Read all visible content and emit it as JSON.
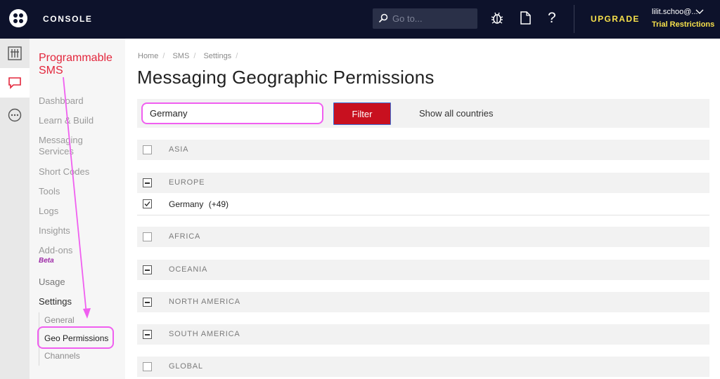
{
  "topbar": {
    "console_label": "CONSOLE",
    "search_placeholder": "Go to...",
    "upgrade_label": "UPGRADE",
    "account_name": "lilit.schoo@...",
    "trial_label": "Trial Restrictions"
  },
  "sidebar": {
    "product_title": "Programmable SMS",
    "items": [
      {
        "label": "Dashboard"
      },
      {
        "label": "Learn & Build"
      },
      {
        "label": "Messaging Services"
      },
      {
        "label": "Short Codes"
      },
      {
        "label": "Tools"
      },
      {
        "label": "Logs"
      },
      {
        "label": "Insights"
      },
      {
        "label": "Add-ons"
      },
      {
        "label": "Usage"
      },
      {
        "label": "Settings"
      }
    ],
    "beta_label": "Beta",
    "settings_sub": [
      {
        "label": "General"
      },
      {
        "label": "Geo Permissions"
      },
      {
        "label": "Channels"
      }
    ]
  },
  "breadcrumb": [
    "Home",
    "SMS",
    "Settings"
  ],
  "page_title": "Messaging Geographic Permissions",
  "filter": {
    "value": "Germany",
    "button_label": "Filter",
    "show_all_label": "Show all countries"
  },
  "regions": [
    {
      "label": "ASIA",
      "state": "unchecked"
    },
    {
      "label": "EUROPE",
      "state": "indeterminate"
    },
    {
      "label": "AFRICA",
      "state": "unchecked"
    },
    {
      "label": "OCEANIA",
      "state": "indeterminate"
    },
    {
      "label": "NORTH AMERICA",
      "state": "indeterminate"
    },
    {
      "label": "SOUTH AMERICA",
      "state": "indeterminate"
    },
    {
      "label": "GLOBAL",
      "state": "unchecked"
    }
  ],
  "country": {
    "name": "Germany",
    "code": "(+49)",
    "checked": true
  },
  "colors": {
    "topbar": "#0d122b",
    "accent_red": "#e3263c",
    "filter_red": "#c8101f",
    "upgrade_yellow": "#f6e04b",
    "annotation_pink": "#f05ff0"
  }
}
